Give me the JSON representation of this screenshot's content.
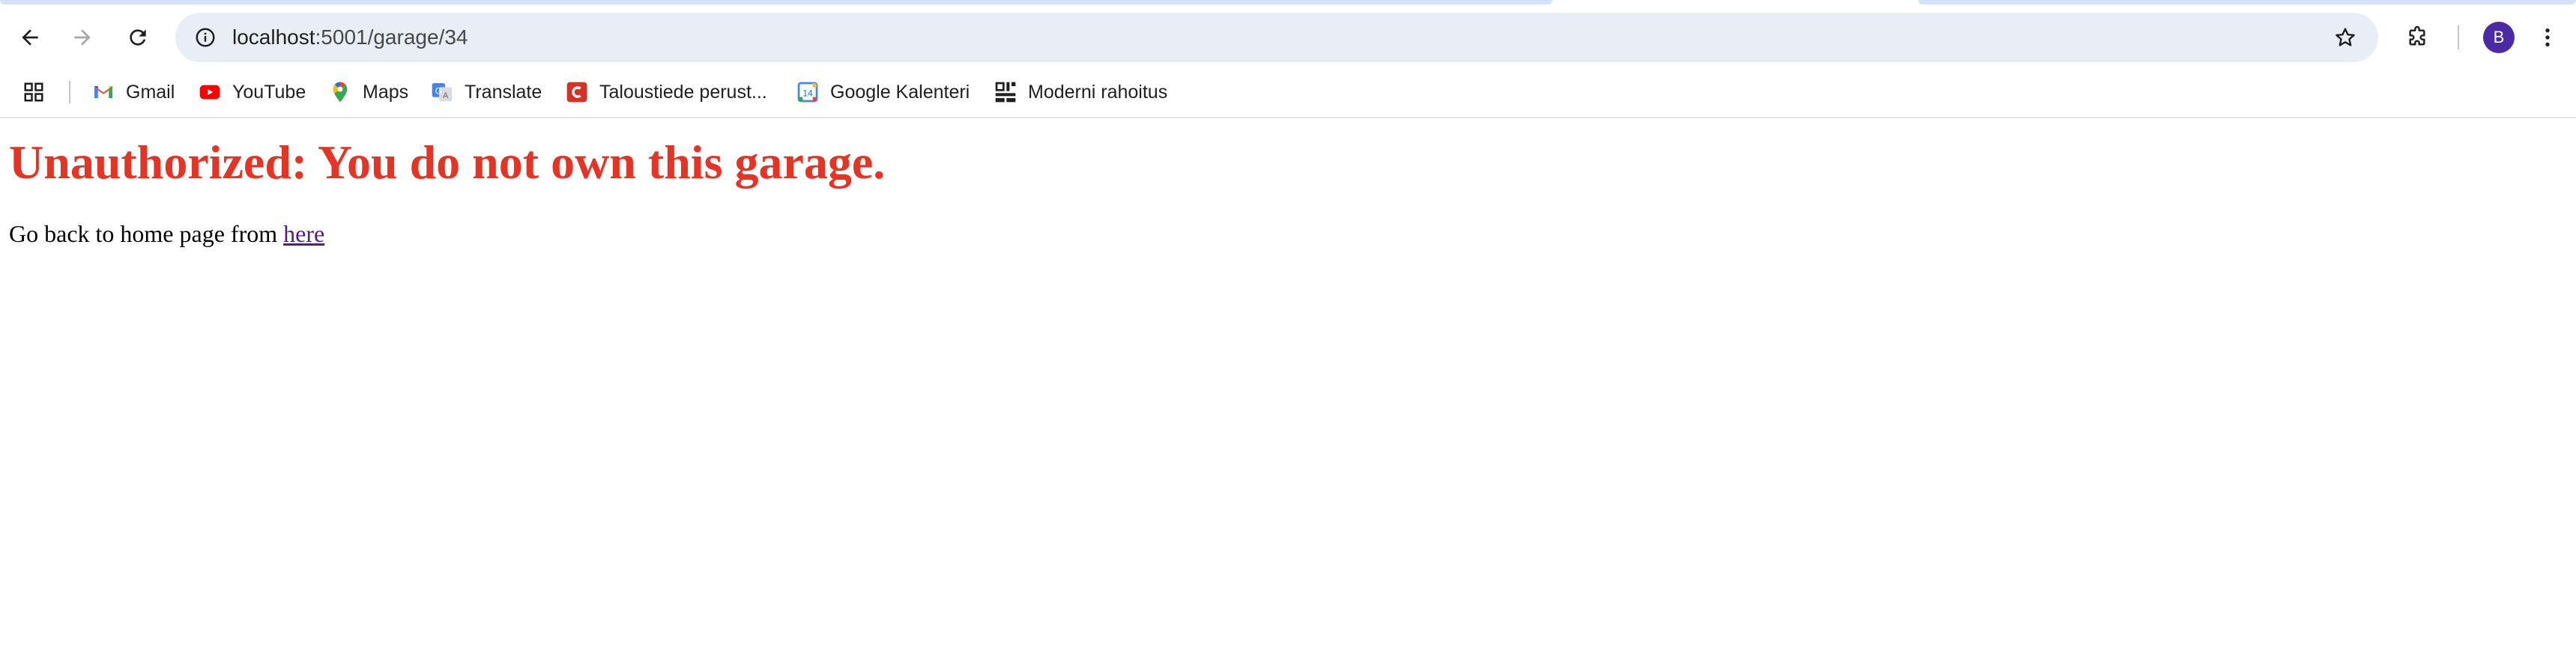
{
  "browser": {
    "omnibox": {
      "host": "localhost",
      "path": ":5001/garage/34"
    },
    "profile_initial": "B",
    "bookmarks": [
      {
        "label": "Gmail",
        "icon": "gmail-icon"
      },
      {
        "label": "YouTube",
        "icon": "youtube-icon"
      },
      {
        "label": "Maps",
        "icon": "maps-icon"
      },
      {
        "label": "Translate",
        "icon": "translate-icon"
      },
      {
        "label": "Taloustiede perust...",
        "icon": "course-icon"
      },
      {
        "label": "Google Kalenteri",
        "icon": "calendar-icon"
      },
      {
        "label": "Moderni rahoitus",
        "icon": "site-icon"
      }
    ],
    "calendar_day": "14"
  },
  "page": {
    "title": "Unauthorized: You do not own this garage.",
    "back_text": "Go back to home page from ",
    "back_link": "here"
  },
  "colors": {
    "error_red": "#e63323",
    "visited_link": "#551a8b",
    "omnibox_bg": "#e9eef6",
    "avatar_bg": "#4b2aa3"
  }
}
